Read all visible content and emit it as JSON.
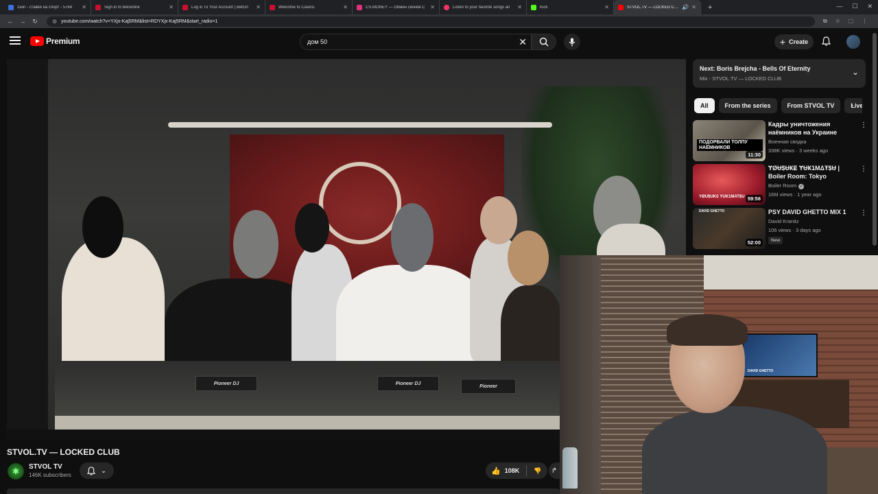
{
  "browser": {
    "tabs": [
      {
        "title": "1win - ставки на спорт - 5764",
        "favicon_color": "#3c6fd8"
      },
      {
        "title": "Sign in to Betonline",
        "favicon_color": "#c8102e"
      },
      {
        "title": "Log in To Your Account | BetOn",
        "favicon_color": "#c8102e"
      },
      {
        "title": "Welcome to Casino.",
        "favicon_color": "#c8102e"
      },
      {
        "title": "CS.MONEY — Обмен скинов C",
        "favicon_color": "#e0307a"
      },
      {
        "title": "Listen to your favorite songs an",
        "favicon_color": "#ff3366"
      },
      {
        "title": "Kick",
        "favicon_color": "#53fc18"
      },
      {
        "title": "STVOL.TV — LOCKED CLUB",
        "favicon_color": "#ff0000"
      }
    ],
    "url": "youtube.com/watch?v=YXjx-Kaj5RM&list=RDYXjx-Kaj5RM&start_radio=1"
  },
  "header": {
    "logo_text": "Premium",
    "search_value": "дом 50",
    "create_label": "Create"
  },
  "video": {
    "title": "STVOL.TV — LOCKED CLUB",
    "channel_name": "STVOL TV",
    "subscribers": "146K subscribers",
    "likes": "108K",
    "deck_label_1": "Pioneer DJ",
    "deck_label_2": "Pioneer DJ",
    "deck_label_3": "Pioneer"
  },
  "sidebar": {
    "next_title": "Next: Boris Brejcha - Bells Of Eternity",
    "next_sub": "Mix - STVOL.TV — LOCKED CLUB",
    "chips": [
      "All",
      "From the series",
      "From STVOL TV",
      "Live"
    ],
    "recommendations": [
      {
        "title": "Кадры уничтожения наёмников на Украине",
        "channel": "Военная сводка",
        "meta": "338K views · 3 weeks ago",
        "duration": "11:30",
        "thumb_text": "ПОДОРВАЛИ ТОЛПУ НАЁМНИКОВ"
      },
      {
        "title": "ɎØɄ$ɄҜɆ ɎɄҜ1MΔŦ$Ʉ | Boiler Room: Tokyo",
        "channel": "Boiler Room",
        "meta": "16M views · 1 year ago",
        "duration": "59:56",
        "thumb_text": "YØU$UKƐ YUK1MAT$U"
      },
      {
        "title": "PSY DAVID GHETTO MIX 1",
        "channel": "David Kranitz",
        "meta": "106 views · 3 days ago",
        "duration": "52:00",
        "badge": "New",
        "thumb_text": "DAVID GHETTO"
      }
    ]
  },
  "webcam": {
    "tv_label": "DAVID GHETTO"
  },
  "colors": {
    "background": "#0f0f0f",
    "accent": "#ff0000",
    "chip_bg": "#272727"
  }
}
